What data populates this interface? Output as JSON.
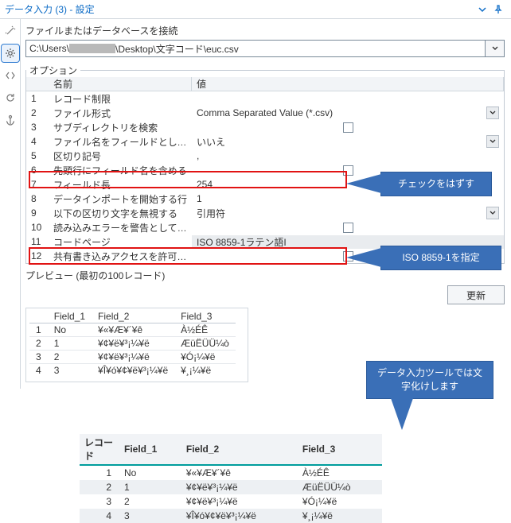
{
  "title": "データ入力 (3) - 設定",
  "connect_label": "ファイルまたはデータベースを接続",
  "path": {
    "prefix": "C:\\Users\\",
    "suffix": "\\Desktop\\文字コード\\euc.csv"
  },
  "options_legend": "オプション",
  "header": {
    "name": "名前",
    "value": "値"
  },
  "rows": [
    {
      "idx": "1",
      "name": "レコード制限",
      "value": ""
    },
    {
      "idx": "2",
      "name": "ファイル形式",
      "value": "Comma Separated Value (*.csv)",
      "dd": true
    },
    {
      "idx": "3",
      "name": "サブディレクトリを検索",
      "value": "",
      "chk": true
    },
    {
      "idx": "4",
      "name": "ファイル名をフィールドとして出力する",
      "value": "いいえ",
      "dd": true
    },
    {
      "idx": "5",
      "name": "区切り記号",
      "value": ","
    },
    {
      "idx": "6",
      "name": "先頭行にフィールド名を含める",
      "value": "",
      "chk": true
    },
    {
      "idx": "7",
      "name": "フィールド長",
      "value": "254"
    },
    {
      "idx": "8",
      "name": "データインポートを開始する行",
      "value": "1"
    },
    {
      "idx": "9",
      "name": "以下の区切り文字を無視する",
      "value": "引用符",
      "dd": true
    },
    {
      "idx": "10",
      "name": "読み込みエラーを警告として扱う",
      "value": "",
      "chk": true
    },
    {
      "idx": "11",
      "name": "コードページ",
      "value": "ISO 8859-1ラテン語I"
    },
    {
      "idx": "12",
      "name": "共有書き込みアクセスを許可する",
      "value": "",
      "chk": true
    }
  ],
  "preview_label": "プレビュー (最初の100レコード)",
  "update_btn": "更新",
  "preview1": {
    "headers": [
      "",
      "Field_1",
      "Field_2",
      "Field_3"
    ],
    "rows": [
      [
        "1",
        "No",
        "¥«¥Æ¥´¥ê",
        "À½ÉÊ"
      ],
      [
        "2",
        "1",
        "¥¢¥ë¥³¡¼¥ë",
        "ÆüËÜÜ¼ò"
      ],
      [
        "3",
        "2",
        "¥¢¥ë¥³¡¼¥ë",
        "¥Ó¡¼¥ë"
      ],
      [
        "4",
        "3",
        "¥Î¥ó¥¢¥ë¥³¡¼¥ë",
        "¥¸¡¼¥ë"
      ]
    ]
  },
  "preview2": {
    "headers": [
      "レコード",
      "Field_1",
      "Field_2",
      "Field_3"
    ],
    "rows": [
      [
        "1",
        "No",
        "¥«¥Æ¥´¥ê",
        "À½ÉÊ"
      ],
      [
        "2",
        "1",
        "¥¢¥ë¥³¡¼¥ë",
        "ÆüËÜÜ¼ò"
      ],
      [
        "3",
        "2",
        "¥¢¥ë¥³¡¼¥ë",
        "¥Ó¡¼¥ë"
      ],
      [
        "4",
        "3",
        "¥Î¥ó¥¢¥ë¥³¡¼¥ë",
        "¥¸¡¼¥ë"
      ]
    ]
  },
  "callouts": {
    "c1": "チェックをはずす",
    "c2": "ISO 8859-1を指定",
    "c3": "データ入力ツールでは文字化けします"
  }
}
